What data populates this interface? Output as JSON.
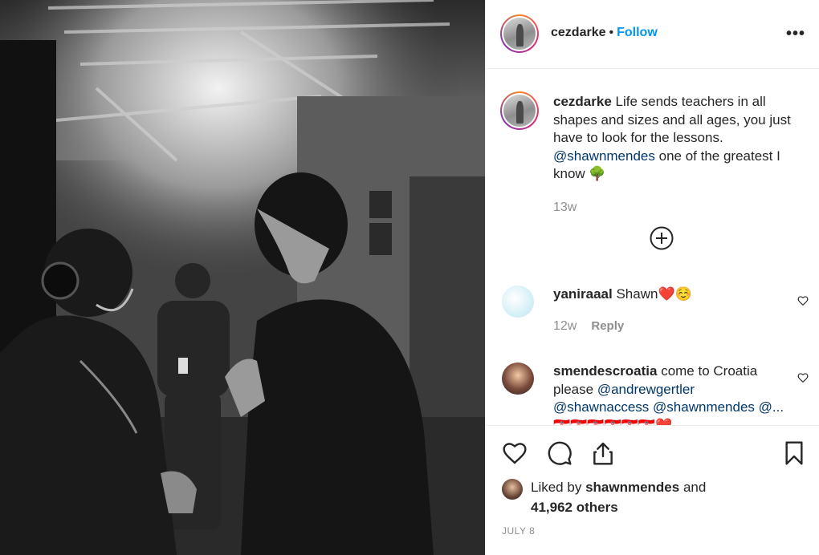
{
  "photo": {
    "alt_icon": "backstage-photo"
  },
  "header": {
    "username": "cezdarke",
    "separator": "•",
    "follow_label": "Follow",
    "more_icon": "more-options-icon"
  },
  "caption": {
    "username": "cezdarke",
    "text_1": "Life sends teachers in all shapes and sizes and all ages, you just have to look for the lessons.",
    "mention": "@shawnmendes",
    "text_2": "one of the greatest I know",
    "emoji": "🌳",
    "time": "13w"
  },
  "load_more_icon": "plus-circle-icon",
  "comments": [
    {
      "username": "yaniraaal",
      "text": "Shawn",
      "emoji": "❤️☺️",
      "time": "12w",
      "reply_label": "Reply"
    },
    {
      "username": "smendescroatia",
      "text_1": "come to Croatia please",
      "mention_1": "@andrewgertler",
      "mention_2": "@shawnaccess",
      "mention_3": "@shawnmendes",
      "partial": "@...",
      "emoji_row": "🇭🇷🇭🇷🇭🇷🇭🇷🇭🇷🇭🇷❤️"
    }
  ],
  "likes": {
    "prefix": "Liked by",
    "user": "shawnmendes",
    "connector": "and",
    "others": "41,962 others"
  },
  "date": "JULY 8",
  "colors": {
    "accent": "#0095f6",
    "mention": "#00376b",
    "muted": "#8e8e8e",
    "heart_red": "#ed4956"
  }
}
